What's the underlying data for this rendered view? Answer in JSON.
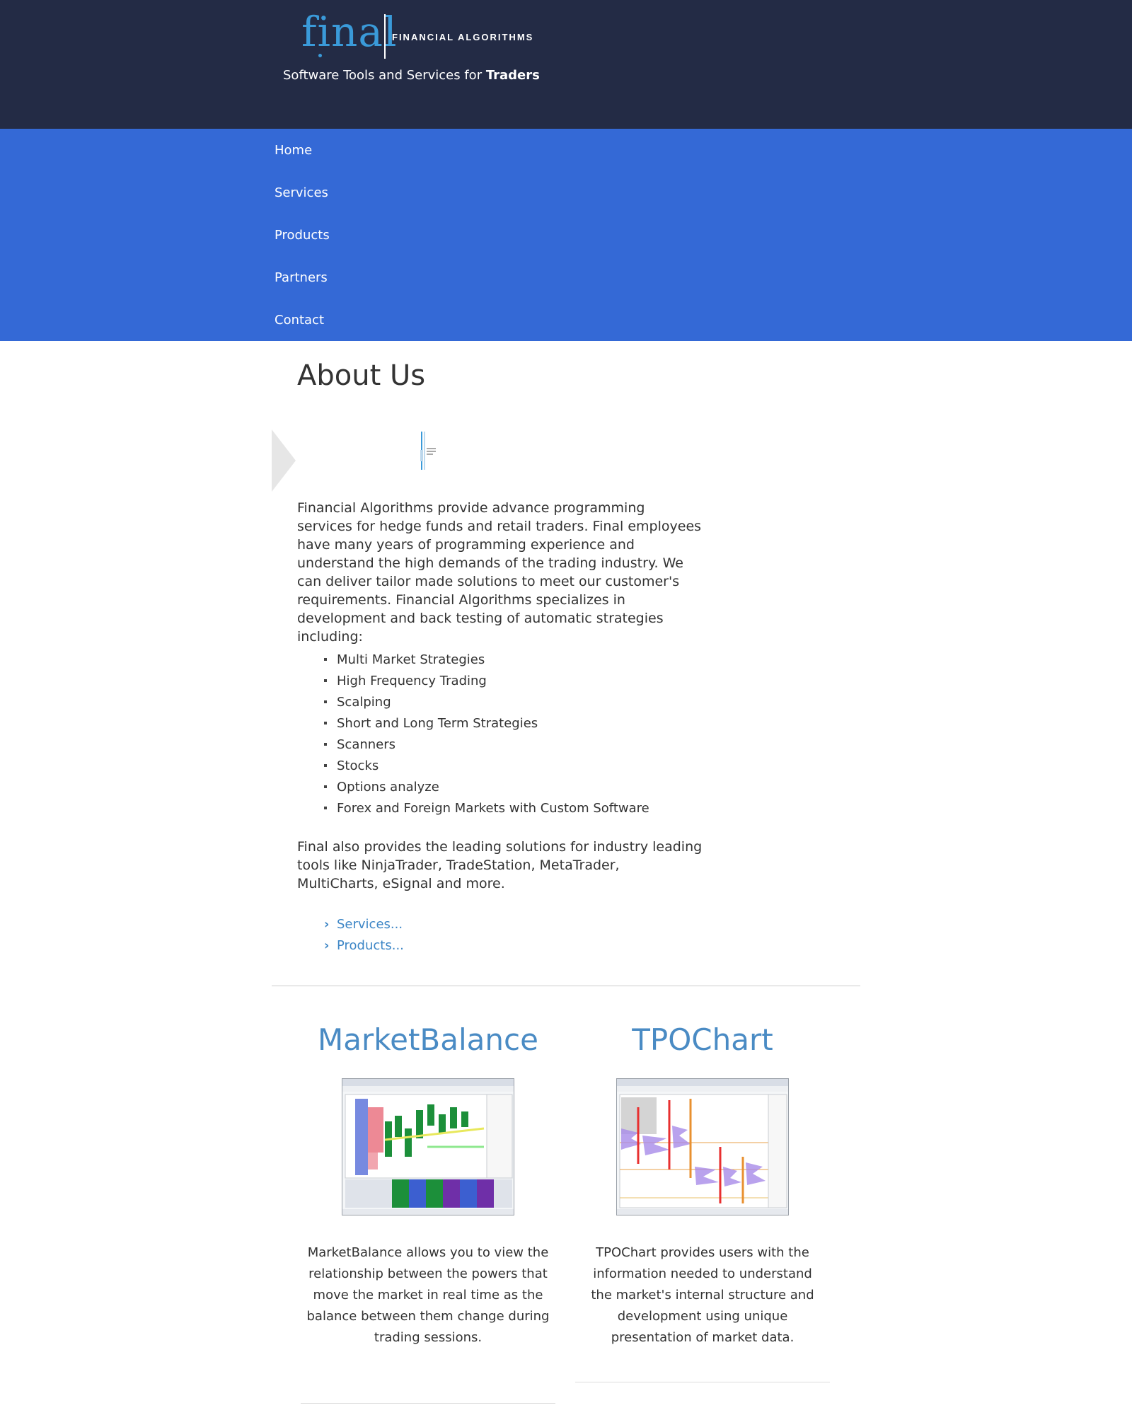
{
  "header": {
    "logo_word": "final",
    "logo_sub": "FINANCIAL ALGORITHMS",
    "tagline_prefix": "Software Tools and Services for ",
    "tagline_bold": "Traders"
  },
  "nav": {
    "items": [
      {
        "label": "Home"
      },
      {
        "label": "Services"
      },
      {
        "label": "Products"
      },
      {
        "label": "Partners"
      },
      {
        "label": "Contact"
      }
    ]
  },
  "main": {
    "title": "About Us",
    "intro": "Financial Algorithms provide advance programming services for hedge funds and retail traders. Final employees have many years of programming experience and understand the high demands of the trading industry. We can deliver tailor made solutions to meet our customer's requirements. Financial Algorithms specializes in development and back testing of automatic strategies including:",
    "strategies": [
      "Multi Market Strategies",
      "High Frequency Trading",
      "Scalping",
      "Short and Long Term Strategies",
      "Scanners",
      "Stocks",
      "Options analyze",
      "Forex and Foreign Markets with Custom Software"
    ],
    "outro": "Final also provides the leading solutions for industry leading tools like NinjaTrader, TradeStation, MetaTrader, MultiCharts, eSignal and more.",
    "links": [
      {
        "label": "Services..."
      },
      {
        "label": "Products..."
      }
    ]
  },
  "products": [
    {
      "title": "MarketBalance",
      "description": "MarketBalance allows you to view the relationship between the powers that move the market in real time as the balance between them change during trading sessions."
    },
    {
      "title": "TPOChart",
      "description": "TPOChart provides users with the information needed to understand the market's internal structure and development using unique presentation of market data."
    }
  ],
  "colors": {
    "header_bg": "#232b45",
    "nav_bg": "#3469d6",
    "logo_accent": "#3a9ad9",
    "link": "#3d86c6",
    "product_title": "#4a8bc4"
  }
}
